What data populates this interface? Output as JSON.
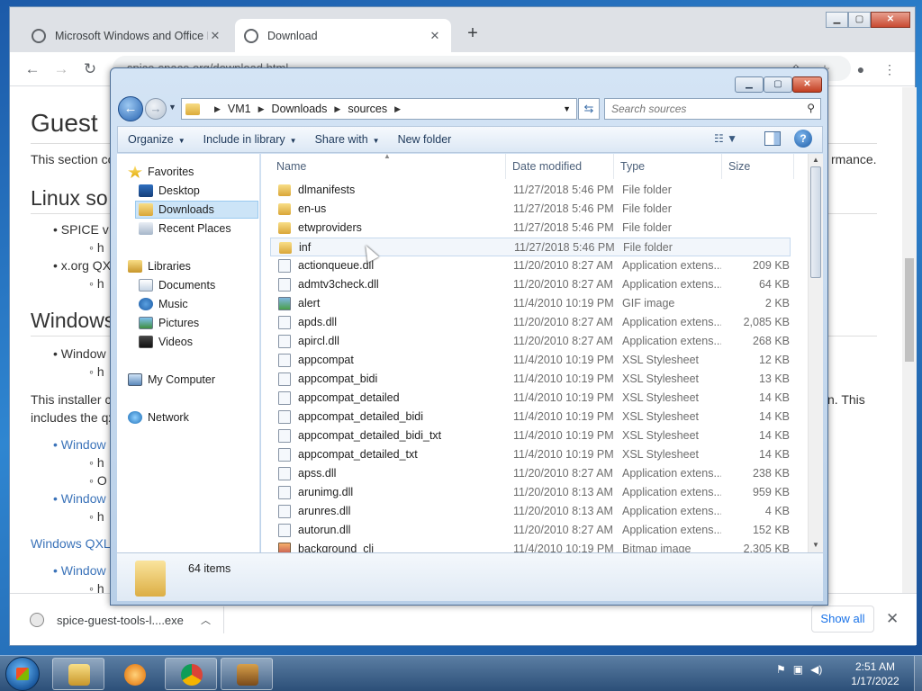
{
  "chrome": {
    "tabs": [
      {
        "label": "Microsoft Windows and Office IS"
      },
      {
        "label": "Download"
      }
    ],
    "new_tab_label": "+",
    "address": "spice-space.org/download.html",
    "page": {
      "title": "Guest",
      "intro": "This section co",
      "intro_tail": "rmance.",
      "linux_heading": "Linux so",
      "linux_item1": "SPICE v",
      "linux_item1_sub": "h",
      "linux_item2": "x.org QX",
      "linux_item2_sub": "h",
      "windows_heading": "Windows",
      "windows_item1": "Window",
      "windows_item1_sub": "h",
      "installer_text": "This installer c",
      "installer_text_tail": "n. This",
      "includes_text": "includes the qx",
      "link1": "Window",
      "link1_sub1": "h",
      "link1_sub2": "O",
      "link2": "Window",
      "link2_sub": "h",
      "qxl_link": "Windows QXL",
      "link3": "Window",
      "link3_sub": "h"
    },
    "download": {
      "filename": "spice-guest-tools-l....exe",
      "show_all": "Show all"
    }
  },
  "explorer": {
    "breadcrumb": [
      "VM1",
      "Downloads",
      "sources"
    ],
    "search_placeholder": "Search sources",
    "commands": [
      "Organize",
      "Include in library",
      "Share with",
      "New folder"
    ],
    "nav": {
      "favorites": "Favorites",
      "desktop": "Desktop",
      "downloads": "Downloads",
      "recent": "Recent Places",
      "libraries": "Libraries",
      "documents": "Documents",
      "music": "Music",
      "pictures": "Pictures",
      "videos": "Videos",
      "computer": "My Computer",
      "network": "Network"
    },
    "columns": {
      "name": "Name",
      "date": "Date modified",
      "type": "Type",
      "size": "Size"
    },
    "files": [
      {
        "name": "dlmanifests",
        "date": "11/27/2018 5:46 PM",
        "type": "File folder",
        "size": "",
        "kind": "folder"
      },
      {
        "name": "en-us",
        "date": "11/27/2018 5:46 PM",
        "type": "File folder",
        "size": "",
        "kind": "folder"
      },
      {
        "name": "etwproviders",
        "date": "11/27/2018 5:46 PM",
        "type": "File folder",
        "size": "",
        "kind": "folder"
      },
      {
        "name": "inf",
        "date": "11/27/2018 5:46 PM",
        "type": "File folder",
        "size": "",
        "kind": "folder"
      },
      {
        "name": "actionqueue.dll",
        "date": "11/20/2010 8:27 AM",
        "type": "Application extens...",
        "size": "209 KB",
        "kind": "file"
      },
      {
        "name": "admtv3check.dll",
        "date": "11/20/2010 8:27 AM",
        "type": "Application extens...",
        "size": "64 KB",
        "kind": "file"
      },
      {
        "name": "alert",
        "date": "11/4/2010 10:19 PM",
        "type": "GIF image",
        "size": "2 KB",
        "kind": "gif"
      },
      {
        "name": "apds.dll",
        "date": "11/20/2010 8:27 AM",
        "type": "Application extens...",
        "size": "2,085 KB",
        "kind": "file"
      },
      {
        "name": "apircl.dll",
        "date": "11/20/2010 8:27 AM",
        "type": "Application extens...",
        "size": "268 KB",
        "kind": "file"
      },
      {
        "name": "appcompat",
        "date": "11/4/2010 10:19 PM",
        "type": "XSL Stylesheet",
        "size": "12 KB",
        "kind": "file"
      },
      {
        "name": "appcompat_bidi",
        "date": "11/4/2010 10:19 PM",
        "type": "XSL Stylesheet",
        "size": "13 KB",
        "kind": "file"
      },
      {
        "name": "appcompat_detailed",
        "date": "11/4/2010 10:19 PM",
        "type": "XSL Stylesheet",
        "size": "14 KB",
        "kind": "file"
      },
      {
        "name": "appcompat_detailed_bidi",
        "date": "11/4/2010 10:19 PM",
        "type": "XSL Stylesheet",
        "size": "14 KB",
        "kind": "file"
      },
      {
        "name": "appcompat_detailed_bidi_txt",
        "date": "11/4/2010 10:19 PM",
        "type": "XSL Stylesheet",
        "size": "14 KB",
        "kind": "file"
      },
      {
        "name": "appcompat_detailed_txt",
        "date": "11/4/2010 10:19 PM",
        "type": "XSL Stylesheet",
        "size": "14 KB",
        "kind": "file"
      },
      {
        "name": "apss.dll",
        "date": "11/20/2010 8:27 AM",
        "type": "Application extens...",
        "size": "238 KB",
        "kind": "file"
      },
      {
        "name": "arunimg.dll",
        "date": "11/20/2010 8:13 AM",
        "type": "Application extens...",
        "size": "959 KB",
        "kind": "file"
      },
      {
        "name": "arunres.dll",
        "date": "11/20/2010 8:13 AM",
        "type": "Application extens...",
        "size": "4 KB",
        "kind": "file"
      },
      {
        "name": "autorun.dll",
        "date": "11/20/2010 8:27 AM",
        "type": "Application extens...",
        "size": "152 KB",
        "kind": "file"
      },
      {
        "name": "background_cli",
        "date": "11/4/2010 10:19 PM",
        "type": "Bitmap image",
        "size": "2,305 KB",
        "kind": "bmp"
      }
    ],
    "item_count": "64 items"
  },
  "taskbar": {
    "clock_time": "2:51 AM",
    "clock_date": "1/17/2022"
  }
}
